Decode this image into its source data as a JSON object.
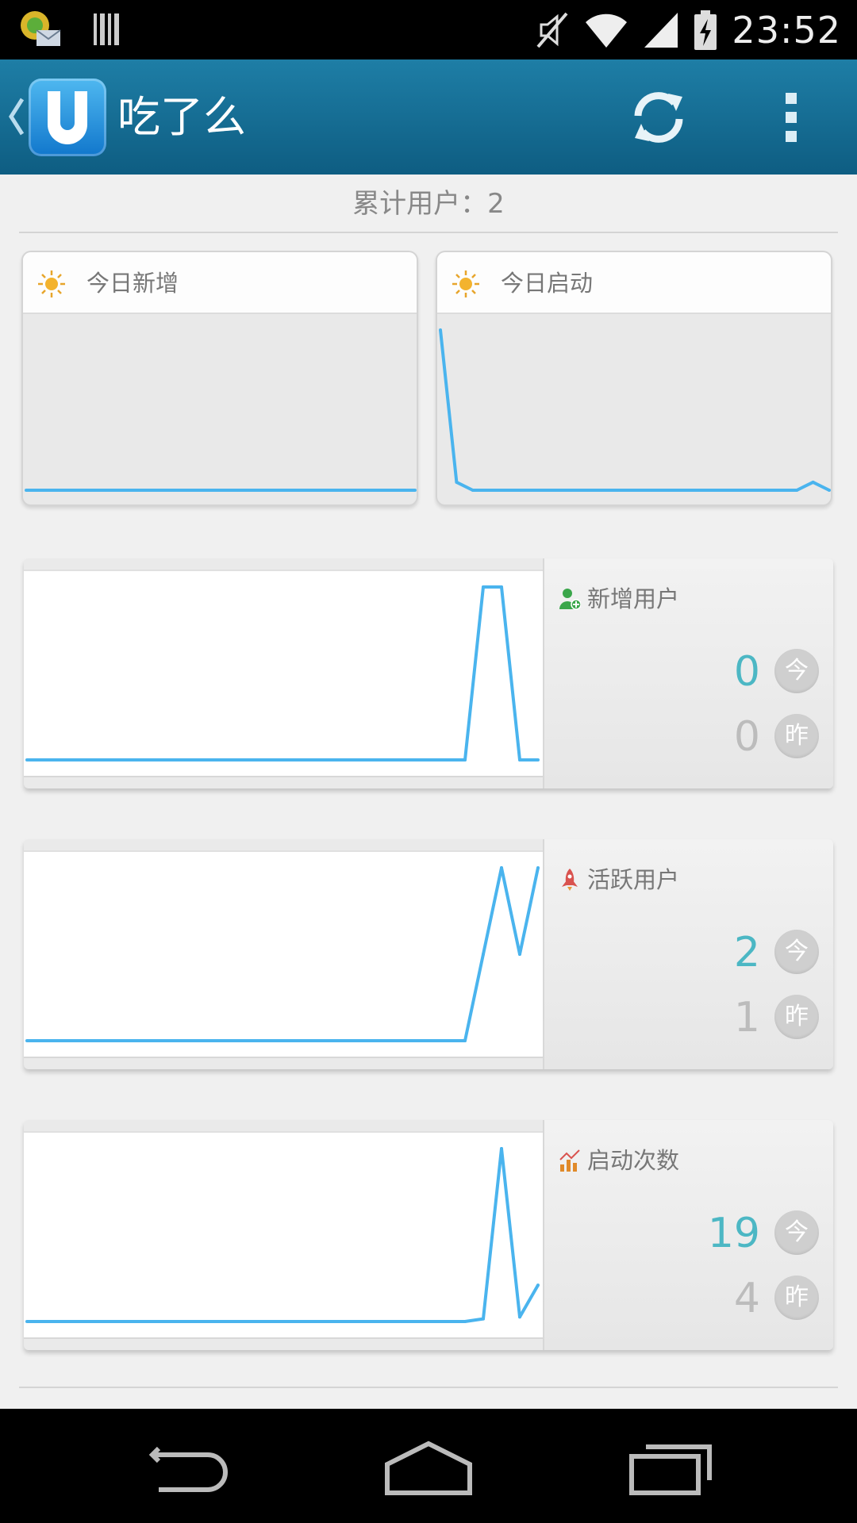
{
  "status_bar": {
    "time": "23:52",
    "icons": [
      "notification-app-icon",
      "barcode-icon",
      "mute-icon",
      "wifi-icon",
      "signal-icon",
      "battery-charging-icon"
    ]
  },
  "app_bar": {
    "title": "吃了么",
    "logo_letter": "U",
    "back_icon": "chevron-left-icon",
    "refresh_icon": "refresh-icon",
    "overflow_icon": "overflow-menu-icon"
  },
  "summary": {
    "total_users_label": "累计用户：",
    "total_users_value": "2"
  },
  "small_cards": [
    {
      "title": "今日新增",
      "icon": "sun-icon",
      "series": [
        0,
        0,
        0,
        0,
        0,
        0,
        0,
        0,
        0,
        0,
        0,
        0,
        0,
        0,
        0,
        0,
        0,
        0,
        0,
        0,
        0,
        0,
        0,
        0,
        0
      ]
    },
    {
      "title": "今日启动",
      "icon": "sun-icon",
      "series": [
        10,
        0.5,
        0,
        0,
        0,
        0,
        0,
        0,
        0,
        0,
        0,
        0,
        0,
        0,
        0,
        0,
        0,
        0,
        0,
        0,
        0,
        0,
        0,
        0.5,
        0
      ]
    }
  ],
  "metrics": [
    {
      "title": "新增用户",
      "icon": "add-user-icon",
      "icon_color": "#3aa64a",
      "today": "0",
      "yesterday": "0",
      "today_badge": "今",
      "yesterday_badge": "昨",
      "series": [
        0,
        0,
        0,
        0,
        0,
        0,
        0,
        0,
        0,
        0,
        0,
        0,
        0,
        0,
        0,
        0,
        0,
        0,
        0,
        0,
        0,
        0,
        0,
        0,
        0,
        1,
        1,
        0,
        0
      ]
    },
    {
      "title": "活跃用户",
      "icon": "rocket-icon",
      "icon_color": "#d9534f",
      "today": "2",
      "yesterday": "1",
      "today_badge": "今",
      "yesterday_badge": "昨",
      "series": [
        0,
        0,
        0,
        0,
        0,
        0,
        0,
        0,
        0,
        0,
        0,
        0,
        0,
        0,
        0,
        0,
        0,
        0,
        0,
        0,
        0,
        0,
        0,
        0,
        0,
        1,
        2,
        1,
        2
      ]
    },
    {
      "title": "启动次数",
      "icon": "bar-trend-icon",
      "icon_color": "#e08a2a",
      "today": "19",
      "yesterday": "4",
      "today_badge": "今",
      "yesterday_badge": "昨",
      "series": [
        0,
        0,
        0,
        0,
        0,
        0,
        0,
        0,
        0,
        0,
        0,
        0,
        0,
        0,
        0,
        0,
        0,
        0,
        0,
        0,
        0,
        0,
        0,
        0,
        0,
        0.3,
        19,
        0.5,
        4
      ]
    }
  ],
  "colors": {
    "accent": "#4ab4ee",
    "value_today": "#4cb7c4",
    "value_yesterday": "#bcbcbc",
    "appbar": "#1676a0"
  },
  "nav_bar": {
    "icons": [
      "back-nav-icon",
      "home-nav-icon",
      "recent-apps-icon"
    ]
  }
}
